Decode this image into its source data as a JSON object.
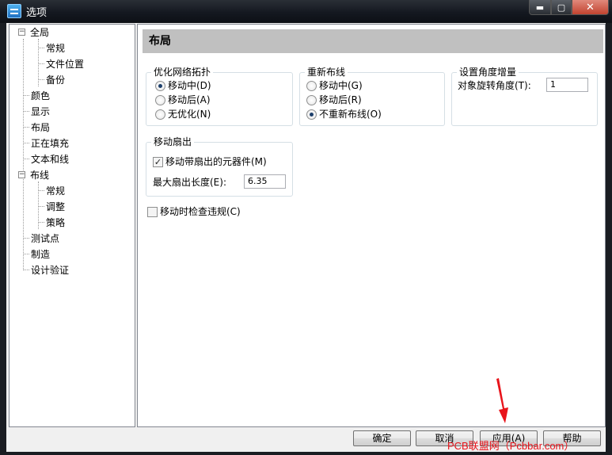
{
  "window": {
    "title": "选项",
    "close_glyph": "✕",
    "minimize_glyph": "▬",
    "maximize_glyph": "▢"
  },
  "tree": {
    "expand_glyph": "−",
    "items": [
      {
        "label": "全局"
      },
      {
        "label": "常规"
      },
      {
        "label": "文件位置"
      },
      {
        "label": "备份"
      },
      {
        "label": "颜色"
      },
      {
        "label": "显示"
      },
      {
        "label": "布局"
      },
      {
        "label": "正在填充"
      },
      {
        "label": "文本和线"
      },
      {
        "label": "布线"
      },
      {
        "label": "常规"
      },
      {
        "label": "调整"
      },
      {
        "label": "策略"
      },
      {
        "label": "测试点"
      },
      {
        "label": "制造"
      },
      {
        "label": "设计验证"
      }
    ]
  },
  "main": {
    "header": "布局",
    "optimize_group": {
      "title": "优化网络拓扑",
      "options": [
        "移动中(D)",
        "移动后(A)",
        "无优化(N)"
      ],
      "selected_index": 0
    },
    "reroute_group": {
      "title": "重新布线",
      "options": [
        "移动中(G)",
        "移动后(R)",
        "不重新布线(O)"
      ],
      "selected_index": 2
    },
    "angle_group": {
      "title": "设置角度增量",
      "rotation_label": "对象旋转角度(T):",
      "rotation_value": "1"
    },
    "fanout_group": {
      "title": "移动扇出",
      "move_fanout_label": "移动带扇出的元器件(M)",
      "move_fanout_checked": true,
      "max_length_label": "最大扇出长度(E):",
      "max_length_value": "6.35"
    },
    "check_violations_label": "移动时检查违规(C)",
    "check_violations_checked": false
  },
  "buttons": {
    "ok": "确定",
    "cancel": "取消",
    "apply": "应用(A)",
    "help": "帮助"
  },
  "watermark": "PCB联盟网（Pcbbar.com）",
  "annotation_color": "#e8141b"
}
